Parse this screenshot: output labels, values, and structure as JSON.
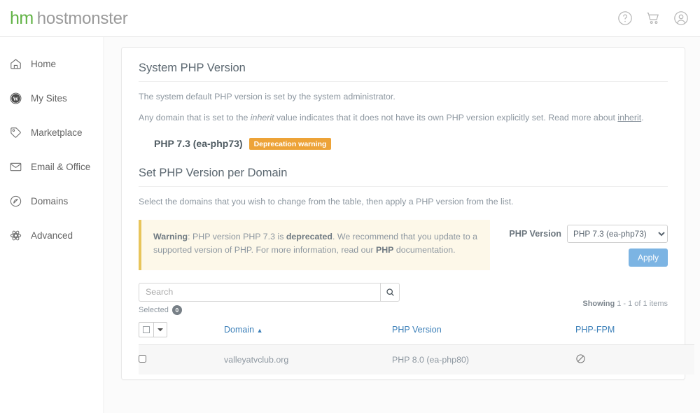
{
  "brand": {
    "mark": "hm",
    "name": "hostmonster"
  },
  "topbar": {
    "help_icon": "help-circle-icon",
    "cart_icon": "shopping-cart-icon",
    "account_icon": "user-account-icon"
  },
  "sidebar": {
    "items": [
      {
        "label": "Home",
        "icon": "home-icon"
      },
      {
        "label": "My Sites",
        "icon": "wordpress-icon"
      },
      {
        "label": "Marketplace",
        "icon": "tag-icon"
      },
      {
        "label": "Email & Office",
        "icon": "envelope-icon"
      },
      {
        "label": "Domains",
        "icon": "domain-circle-icon"
      },
      {
        "label": "Advanced",
        "icon": "advanced-gear-icon"
      }
    ]
  },
  "system_section": {
    "title": "System PHP Version",
    "desc1": "The system default PHP version is set by the system administrator.",
    "desc2_pre": "Any domain that is set to the ",
    "desc2_em": "inherit",
    "desc2_mid": " value indicates that it does not have its own PHP version explicitly set. Read more about ",
    "desc2_link": "inherit",
    "desc2_post": ".",
    "php_version": "PHP 7.3 (ea-php73)",
    "badge": "Deprecation warning",
    "badge_color": "#eda338"
  },
  "domain_section": {
    "title": "Set PHP Version per Domain",
    "desc": "Select the domains that you wish to change from the table, then apply a PHP version from the list."
  },
  "warning": {
    "label": "Warning",
    "text_1": ": PHP version PHP 7.3 is ",
    "bold_1": "deprecated",
    "text_2": ". We recommend that you update to a supported version of PHP. For more information, read our ",
    "link": "PHP",
    "text_3": " documentation.",
    "accent_color": "#e8c55b",
    "bg_color": "#fdf8e9"
  },
  "php_control": {
    "label": "PHP Version",
    "selected": "PHP 7.3 (ea-php73)",
    "options": [
      "PHP 7.3 (ea-php73)"
    ],
    "apply_label": "Apply",
    "apply_color": "#7cb4e3"
  },
  "search": {
    "placeholder": "Search",
    "value": "",
    "icon": "search-icon",
    "selected_label": "Selected",
    "selected_count": "0",
    "showing_prefix": "Showing",
    "showing_text": " 1 - 1 of 1 items"
  },
  "table": {
    "columns": [
      {
        "label": "",
        "name": "select-all"
      },
      {
        "label": "Domain",
        "name": "domain",
        "sort": "▲"
      },
      {
        "label": "PHP Version",
        "name": "php-version"
      },
      {
        "label": "PHP-FPM",
        "name": "php-fpm"
      }
    ],
    "rows": [
      {
        "checked": false,
        "domain": "valleyatvclub.org",
        "php_version": "PHP 8.0 (ea-php80)",
        "php_fpm_icon": "no-entry-icon"
      }
    ]
  }
}
